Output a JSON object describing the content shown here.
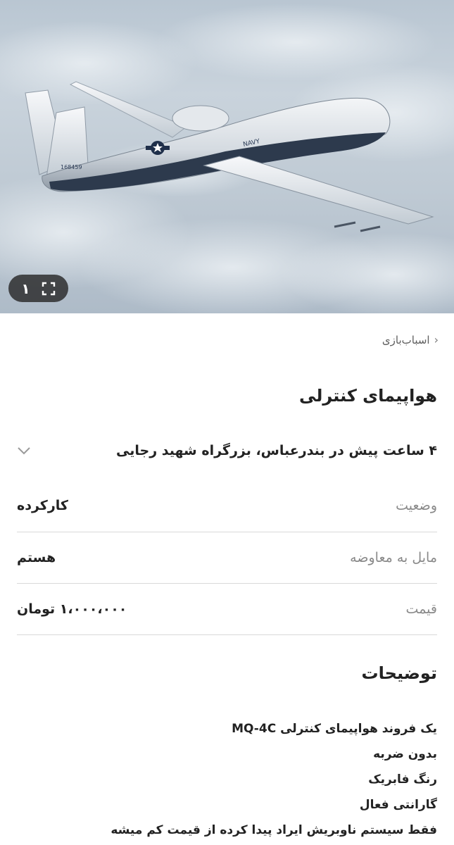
{
  "gallery": {
    "image_count": "۱",
    "expand_icon": "fullscreen-icon",
    "aircraft_serial": "168459",
    "aircraft_marking": "NAVY"
  },
  "breadcrumb": {
    "label": "اسباب‌بازی",
    "icon": "chevron-left-icon"
  },
  "listing": {
    "title": "هواپیمای کنترلی",
    "meta": "۴ ساعت پیش در بندرعباس، بزرگراه شهید رجایی",
    "meta_icon": "chevron-down-icon"
  },
  "details": [
    {
      "label": "وضعیت",
      "value": "کارکرده"
    },
    {
      "label": "مایل به معاوضه",
      "value": "هستم"
    },
    {
      "label": "قیمت",
      "value": "۱،۰۰۰،۰۰۰ تومان"
    }
  ],
  "description": {
    "title": "توضیحات",
    "lines": [
      "یک فروند هواپیمای کنترلی MQ-4C",
      "بدون ضربه",
      "رنگ فابریک",
      "گارانتی فعال",
      "فقط سیستم ناوبریش ایراد پیدا کرده از قیمت کم میشه"
    ]
  }
}
